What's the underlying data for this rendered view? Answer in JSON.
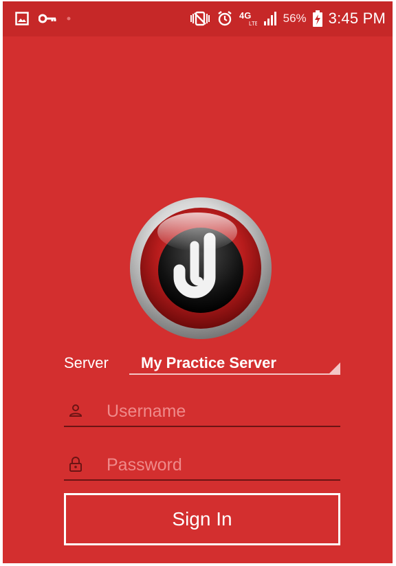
{
  "status_bar": {
    "icons": [
      "gallery-icon",
      "key-icon",
      "dot-icon",
      "vibrate-icon",
      "alarm-icon",
      "4g-lte-icon",
      "signal-icon",
      "battery-charging-icon"
    ],
    "battery_percent": "56%",
    "time": "3:45 PM"
  },
  "logo": {
    "icon": "app-logo-icon"
  },
  "server": {
    "label": "Server",
    "selected": "My Practice Server"
  },
  "username": {
    "placeholder": "Username",
    "value": "",
    "icon": "person-icon"
  },
  "password": {
    "placeholder": "Password",
    "value": "",
    "icon": "lock-icon"
  },
  "signin": {
    "label": "Sign In"
  },
  "colors": {
    "background": "#d32f2f",
    "status_bar": "#c62828",
    "text": "#ffffff",
    "placeholder": "#ef8a8a"
  }
}
